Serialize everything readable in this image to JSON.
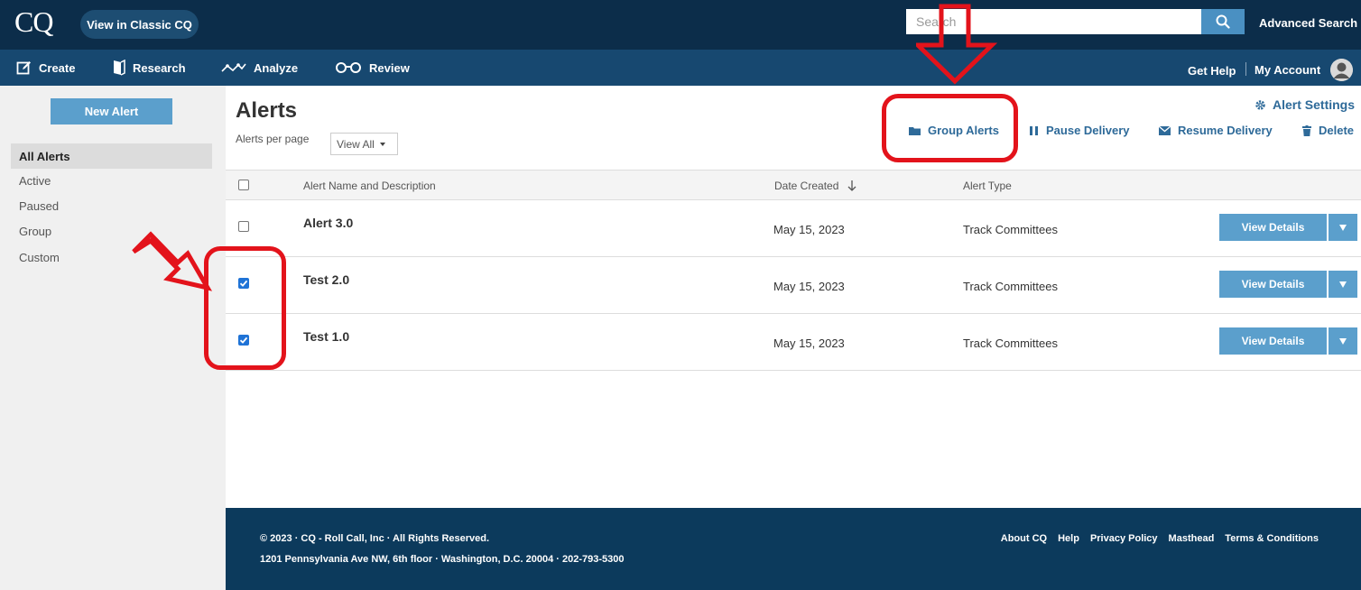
{
  "header": {
    "logo": "CQ",
    "classic_button": "View in Classic CQ",
    "search_placeholder": "Search",
    "advanced_search": "Advanced Search"
  },
  "nav": {
    "items": [
      {
        "label": "Create",
        "icon": "edit-icon"
      },
      {
        "label": "Research",
        "icon": "book-icon"
      },
      {
        "label": "Analyze",
        "icon": "trend-icon"
      },
      {
        "label": "Review",
        "icon": "glasses-icon"
      }
    ],
    "get_help": "Get Help",
    "my_account": "My Account"
  },
  "sidebar": {
    "new_alert": "New Alert",
    "items": [
      {
        "label": "All Alerts",
        "active": true
      },
      {
        "label": "Active"
      },
      {
        "label": "Paused"
      },
      {
        "label": "Group"
      },
      {
        "label": "Custom"
      }
    ]
  },
  "main": {
    "title": "Alerts",
    "per_page_label": "Alerts per page",
    "per_page_value": "View All",
    "alert_settings": "Alert Settings",
    "actions": {
      "group": "Group Alerts",
      "pause": "Pause Delivery",
      "resume": "Resume Delivery",
      "delete": "Delete"
    },
    "columns": {
      "name": "Alert Name and Description",
      "date": "Date Created",
      "type": "Alert Type"
    },
    "rows": [
      {
        "name": "Alert 3.0",
        "date": "May 15, 2023",
        "type": "Track Committees",
        "checked": false,
        "button": "View Details"
      },
      {
        "name": "Test 2.0",
        "date": "May 15, 2023",
        "type": "Track Committees",
        "checked": true,
        "button": "View Details"
      },
      {
        "name": "Test 1.0",
        "date": "May 15, 2023",
        "type": "Track Committees",
        "checked": true,
        "button": "View Details"
      }
    ]
  },
  "footer": {
    "copyright": "© 2023 · CQ - Roll Call, Inc · All Rights Reserved.",
    "address": "1201 Pennsylvania Ave NW, 6th floor · Washington, D.C. 20004 · 202-793-5300",
    "links": [
      "About CQ",
      "Help",
      "Privacy Policy",
      "Masthead",
      "Terms & Conditions"
    ]
  },
  "colors": {
    "header_bg": "#0c2d4a",
    "nav_bg": "#174870",
    "accent": "#5b9fcc",
    "link": "#2e6a99",
    "annotation": "#e3131b"
  }
}
